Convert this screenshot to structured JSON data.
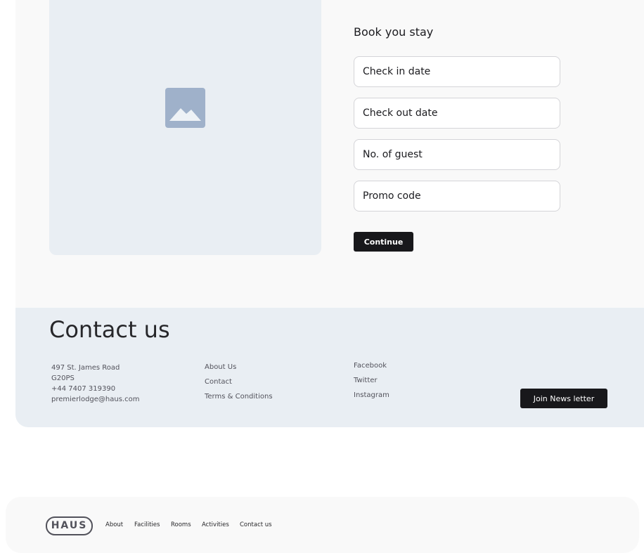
{
  "booking": {
    "image_icon": "image-placeholder-icon",
    "title": "Book you stay",
    "fields": {
      "check_in": "Check in date",
      "check_out": "Check out date",
      "guests": "No. of guest",
      "promo": "Promo code"
    },
    "continue_label": "Continue"
  },
  "contact": {
    "title": "Contact us",
    "address": {
      "line1": "497 St. James Road",
      "line2": "G20PS",
      "phone": "+44 7407 319390",
      "email": "premierlodge@haus.com"
    },
    "links": {
      "about": "About Us",
      "contact": "Contact",
      "terms": "Terms & Conditions"
    },
    "social": {
      "facebook": "Facebook",
      "twitter": "Twitter",
      "instagram": "Instagram"
    },
    "newsletter_label": "Join News letter"
  },
  "nav": {
    "logo": "HAUS",
    "items": {
      "about": "About",
      "facilities": "Facilities",
      "rooms": "Rooms",
      "activities": "Activities",
      "contact": "Contact us"
    }
  },
  "colors": {
    "section_bg": "#f9f9f9",
    "placeholder_bg": "#e9eef3",
    "icon": "#9fb1ca",
    "button": "#18181b"
  }
}
